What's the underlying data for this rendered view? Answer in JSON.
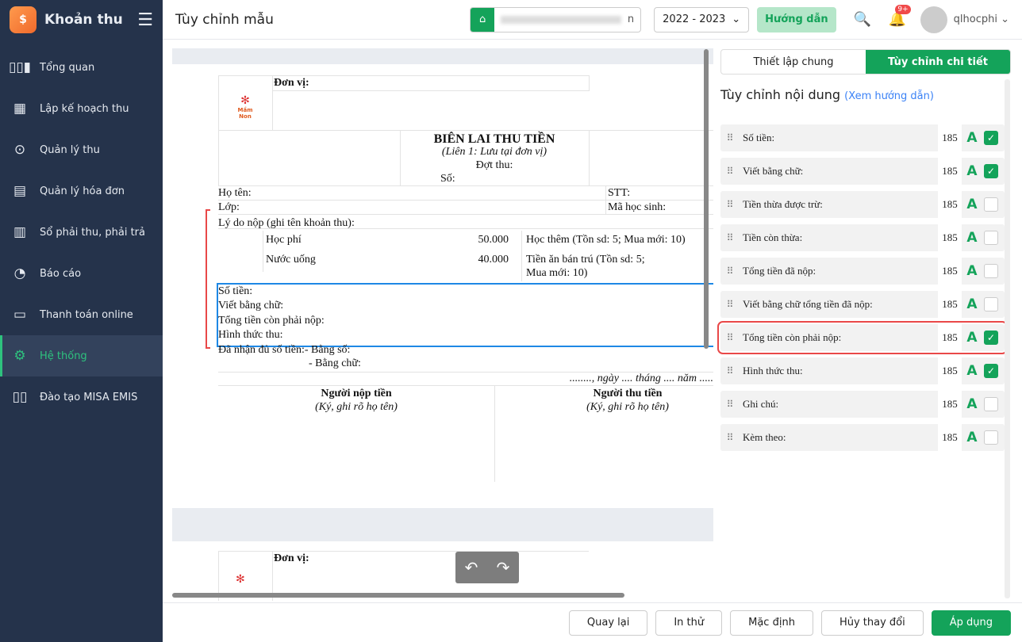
{
  "sidebar": {
    "app_name": "Khoản thu",
    "items": [
      {
        "label": "Tổng quan",
        "icon": "bar-chart-icon"
      },
      {
        "label": "Lập kế hoạch thu",
        "icon": "calendar-money-icon"
      },
      {
        "label": "Quản lý thu",
        "icon": "hand-coin-icon"
      },
      {
        "label": "Quản lý hóa đơn",
        "icon": "invoice-icon"
      },
      {
        "label": "Sổ phải thu, phải trả",
        "icon": "ledger-icon"
      },
      {
        "label": "Báo cáo",
        "icon": "pie-chart-icon"
      },
      {
        "label": "Thanh toán online",
        "icon": "online-payment-icon"
      },
      {
        "label": "Hệ thống",
        "icon": "gear-icon",
        "active": true
      },
      {
        "label": "Đào tạo MISA EMIS",
        "icon": "book-icon"
      }
    ]
  },
  "header": {
    "title": "Tùy chỉnh mẫu",
    "school_suffix": "n",
    "year": "2022 - 2023",
    "guide": "Hướng dẫn",
    "notif_badge": "9+",
    "user": "qlhocphi"
  },
  "doc": {
    "unit": "Đơn vị:",
    "logo_text": "Mầm Non",
    "title": "BIÊN LAI THU TIỀN",
    "subtitle": "(Liên 1: Lưu tại đơn vị)",
    "batch": "Đợt thu:",
    "number": "Số:",
    "name": "Họ tên:",
    "stt": "STT:",
    "class": "Lớp:",
    "student_code": "Mã học sinh:",
    "reason": "Lý do nộp (ghi tên khoản thu):",
    "fees": [
      {
        "name": "Học phí",
        "amount": "50.000"
      },
      {
        "name": "Nước uống",
        "amount": "40.000"
      }
    ],
    "extras": [
      "Học thêm (Tồn sd: 5; Mua mới: 10)",
      "Tiền ăn bán trú (Tồn sd: 5;",
      "Mua mới: 10)"
    ],
    "amount": "Số tiền:",
    "in_words": "Viết bằng chữ:",
    "remaining": "Tổng tiền còn phải nộp:",
    "method": "Hình thức thu:",
    "received": "Đã nhận đủ số tiền:- Bằng số:",
    "received_words": "- Bằng chữ:",
    "date": "........,  ngày .... tháng .... năm .....",
    "payer": "Người nộp tiền",
    "payer_sign": "(Ký, ghi rõ họ tên)",
    "collector": "Người thu tiền",
    "collector_sign": "(Ký, ghi rõ họ tên)"
  },
  "panel": {
    "tabs": [
      "Thiết lập chung",
      "Tùy chỉnh chi tiết"
    ],
    "section_title": "Tùy chỉnh nội dung",
    "guide_link": "(Xem hướng dẫn)",
    "rows": [
      {
        "label": "Số tiền:",
        "size": "185",
        "checked": true
      },
      {
        "label": "Viết bằng chữ:",
        "size": "185",
        "checked": true
      },
      {
        "label": "Tiền thừa được trừ:",
        "size": "185",
        "checked": false
      },
      {
        "label": "Tiền còn thừa:",
        "size": "185",
        "checked": false
      },
      {
        "label": "Tổng tiền đã nộp:",
        "size": "185",
        "checked": false
      },
      {
        "label": "Viết bằng chữ tổng tiền đã nộp:",
        "size": "185",
        "checked": false
      },
      {
        "label": "Tổng tiền còn phải nộp:",
        "size": "185",
        "checked": true,
        "highlighted": true
      },
      {
        "label": "Hình thức thu:",
        "size": "185",
        "checked": true
      },
      {
        "label": "Ghi chú:",
        "size": "185",
        "checked": false
      },
      {
        "label": "Kèm theo:",
        "size": "185",
        "checked": false
      }
    ]
  },
  "footer": {
    "back": "Quay lại",
    "print": "In thử",
    "default": "Mặc định",
    "cancel": "Hủy thay đổi",
    "apply": "Áp dụng"
  }
}
